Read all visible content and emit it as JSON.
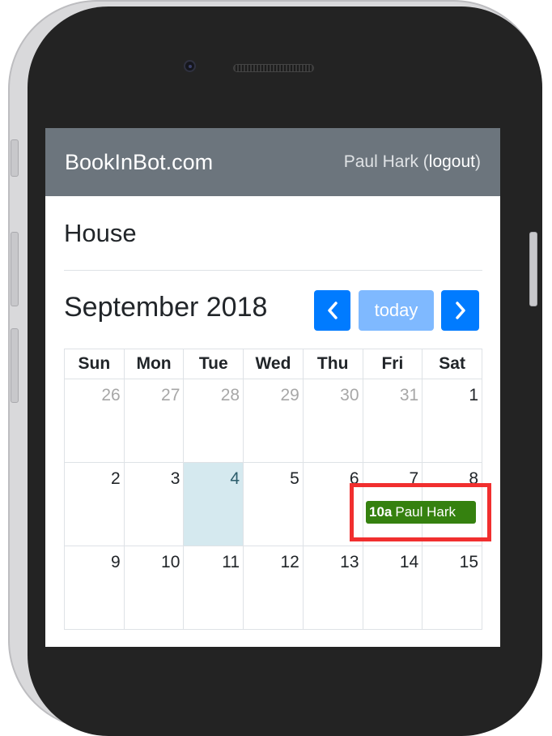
{
  "navbar": {
    "brand": "BookInBot.com",
    "user_name": "Paul Hark",
    "logout_label": "logout"
  },
  "page": {
    "title": "House"
  },
  "calendar": {
    "month_title": "September 2018",
    "prev_icon": "chevron-left-icon",
    "today_label": "today",
    "next_icon": "chevron-right-icon",
    "weekdays": [
      "Sun",
      "Mon",
      "Tue",
      "Wed",
      "Thu",
      "Fri",
      "Sat"
    ],
    "weeks": [
      [
        "26",
        "27",
        "28",
        "29",
        "30",
        "31",
        "1"
      ],
      [
        "2",
        "3",
        "4",
        "5",
        "6",
        "7",
        "8"
      ],
      [
        "9",
        "10",
        "11",
        "12",
        "13",
        "14",
        "15"
      ]
    ],
    "event": {
      "time": "10a",
      "title": "Paul Hark"
    }
  },
  "colors": {
    "navbar": "#6c757d",
    "primary": "#007bff",
    "event": "#35810f",
    "today_bg": "#d5e9ef",
    "highlight": "#f12f2f"
  }
}
